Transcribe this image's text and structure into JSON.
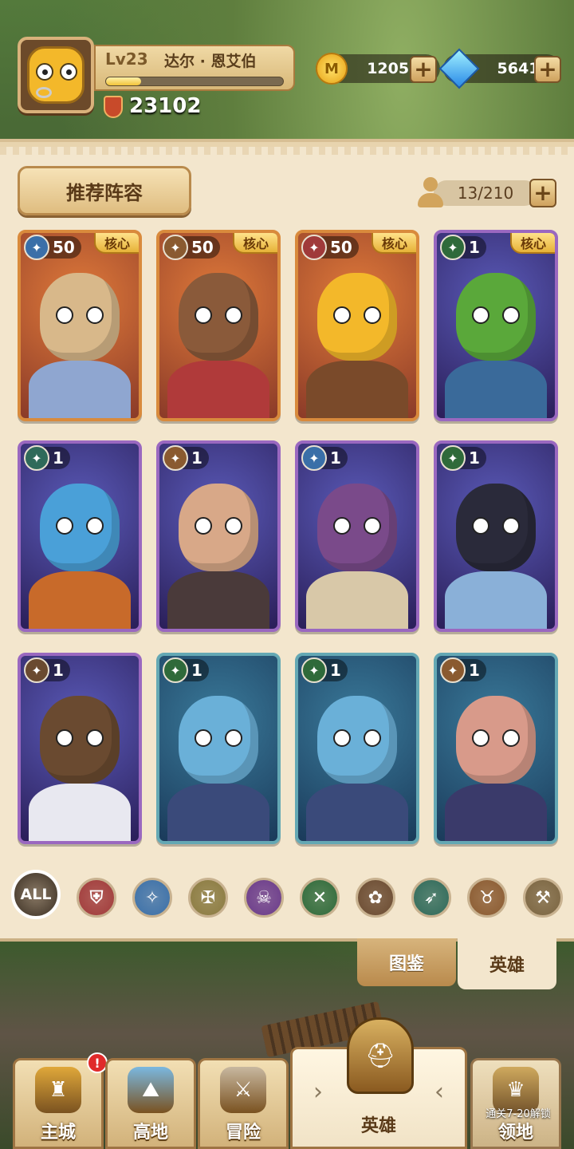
{
  "player": {
    "level_label": "Lv23",
    "name": "达尔 · 恩艾伯",
    "xp_progress": 0.2,
    "power": "23102"
  },
  "resources": {
    "gold": "1205K",
    "gold_icon": "gold-coin-icon",
    "gems": "5641",
    "gems_icon": "diamond-icon",
    "plus_glyph": "+"
  },
  "panel": {
    "recommend_label": "推荐阵容",
    "hero_count": "13/210"
  },
  "cards": [
    {
      "level": "50",
      "core": "核心",
      "class_icon": "staff-class-icon",
      "class_color": "#3a6fa8",
      "frame": "gold",
      "hero": "silver-haired-elf-knight"
    },
    {
      "level": "50",
      "core": "核心",
      "class_icon": "beast-class-icon",
      "class_color": "#8a5a30",
      "frame": "gold",
      "hero": "monkey-king-warrior"
    },
    {
      "level": "50",
      "core": "核心",
      "class_icon": "shield-class-icon",
      "class_color": "#a03a3a",
      "frame": "gold",
      "hero": "yellow-cheese-beast"
    },
    {
      "level": "1",
      "core": "核心",
      "class_icon": "daggers-class-icon",
      "class_color": "#2f6a3a",
      "frame": "purple",
      "hero": "green-goblin"
    },
    {
      "level": "1",
      "core": "",
      "class_icon": "bow-class-icon",
      "class_color": "#2f6a5a",
      "frame": "purple",
      "hero": "blue-fish-jouster"
    },
    {
      "level": "1",
      "core": "",
      "class_icon": "beast-class-icon",
      "class_color": "#8a5a30",
      "frame": "purple",
      "hero": "owl-hammer-girl"
    },
    {
      "level": "1",
      "core": "",
      "class_icon": "staff-class-icon",
      "class_color": "#3a6fa8",
      "frame": "purple",
      "hero": "hooded-skull-mage"
    },
    {
      "level": "1",
      "core": "",
      "class_icon": "daggers-class-icon",
      "class_color": "#2f6a3a",
      "frame": "purple",
      "hero": "masked-ninja-girl"
    },
    {
      "level": "1",
      "core": "",
      "class_icon": "paw-class-icon",
      "class_color": "#6a4a30",
      "frame": "purple",
      "hero": "bull-in-overalls"
    },
    {
      "level": "1",
      "core": "",
      "class_icon": "daggers-class-icon",
      "class_color": "#2f6a3a",
      "frame": "teal",
      "hero": "blue-hooded-assassin"
    },
    {
      "level": "1",
      "core": "",
      "class_icon": "daggers-class-icon",
      "class_color": "#2f6a3a",
      "frame": "teal",
      "hero": "blue-hooded-assassin"
    },
    {
      "level": "1",
      "core": "",
      "class_icon": "beast-class-icon",
      "class_color": "#8a5a30",
      "frame": "teal",
      "hero": "horned-ogre"
    }
  ],
  "filters": [
    {
      "label": "ALL",
      "icon": "all-filter-icon",
      "color": "#4a3e32"
    },
    {
      "label": "",
      "icon": "shield-filter-icon",
      "color": "#a03a3a"
    },
    {
      "label": "",
      "icon": "staff-filter-icon",
      "color": "#3a6fa8"
    },
    {
      "label": "",
      "icon": "holy-crest-filter-icon",
      "color": "#8a7a40"
    },
    {
      "label": "",
      "icon": "skull-filter-icon",
      "color": "#6a3a8a"
    },
    {
      "label": "",
      "icon": "daggers-filter-icon",
      "color": "#2f6a3a"
    },
    {
      "label": "",
      "icon": "paw-filter-icon",
      "color": "#6a4a30"
    },
    {
      "label": "",
      "icon": "bow-filter-icon",
      "color": "#2f6a5a"
    },
    {
      "label": "",
      "icon": "beast-filter-icon",
      "color": "#8a5a30"
    },
    {
      "label": "",
      "icon": "hammer-filter-icon",
      "color": "#7a6440"
    }
  ],
  "subtabs": {
    "codex": "图鉴",
    "heroes": "英雄"
  },
  "nav": [
    {
      "label": "主城",
      "icon": "castle-icon",
      "badge": "!"
    },
    {
      "label": "高地",
      "icon": "highland-icon",
      "badge": ""
    },
    {
      "label": "冒险",
      "icon": "crossed-swords-icon",
      "badge": ""
    },
    {
      "label": "英雄",
      "icon": "hero-helmet-icon",
      "badge": ""
    },
    {
      "label": "领地",
      "icon": "territory-icon",
      "badge": "",
      "lock_text": "通关7-20解锁"
    }
  ],
  "colors": {
    "accent_gold": "#f2c439",
    "panel_bg": "#f3e6cd",
    "badge_red": "#e02a2a"
  }
}
